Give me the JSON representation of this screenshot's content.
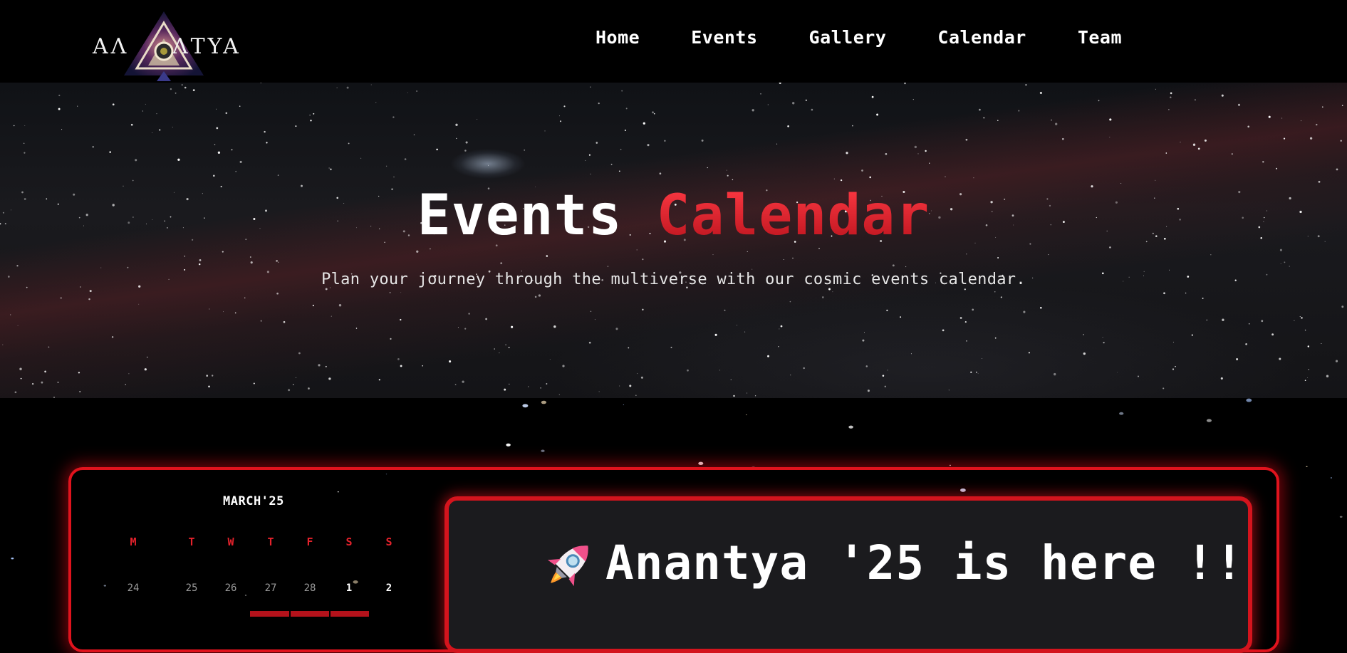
{
  "brand": {
    "logo_text": "ANANTYA",
    "logo_letters_left": "AΛ",
    "logo_letters_right": "ΛTYA"
  },
  "nav": {
    "items": [
      {
        "label": "Home"
      },
      {
        "label": "Events"
      },
      {
        "label": "Gallery"
      },
      {
        "label": "Calendar"
      },
      {
        "label": "Team"
      }
    ]
  },
  "hero": {
    "title_white": "Events",
    "title_red": "Calendar",
    "subtitle": "Plan your journey through the multiverse with our cosmic events calendar."
  },
  "calendar": {
    "month": "MARCH'25",
    "weekdays": [
      "M",
      "T",
      "W",
      "T",
      "F",
      "S",
      "S"
    ],
    "first_week": [
      "24",
      "25",
      "26",
      "27",
      "28",
      "1",
      "2"
    ]
  },
  "announcement": {
    "icon": "rocket-icon",
    "title": "Anantya '25 is here !!"
  },
  "colors": {
    "accent_red": "#e0131d",
    "background": "#000000",
    "card_bg": "#1b1b1e"
  }
}
